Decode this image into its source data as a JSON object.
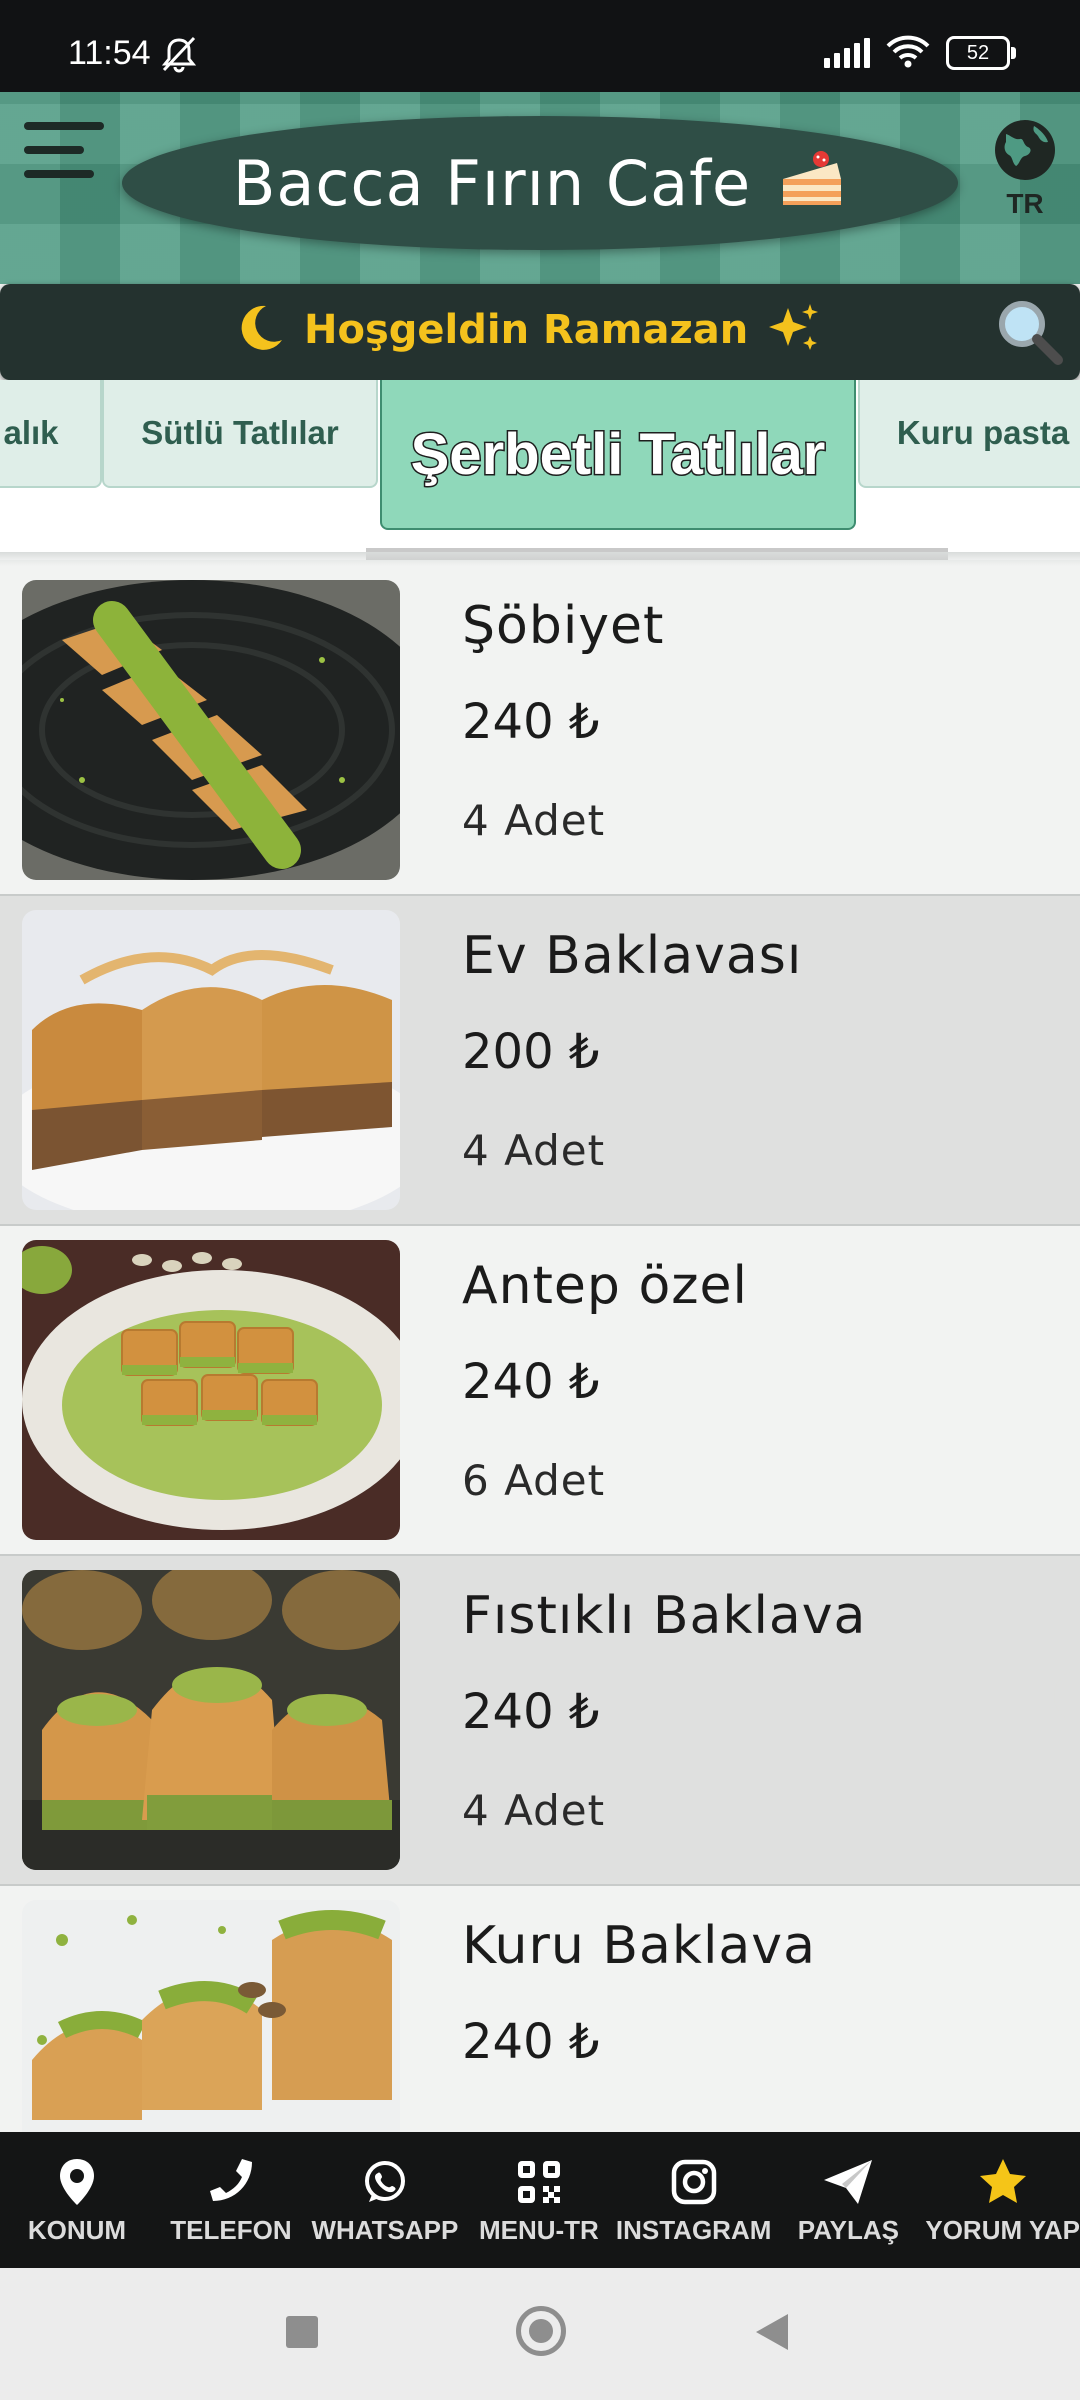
{
  "status_bar": {
    "time": "11:54",
    "battery": "52"
  },
  "header": {
    "title": "Bacca Fırın Cafe",
    "language": "TR"
  },
  "banner": {
    "text": "Hoşgeldin Ramazan"
  },
  "tabs": [
    {
      "label": "alık"
    },
    {
      "label": "Sütlü Tatlılar"
    },
    {
      "label": "Şerbetli Tatlılar",
      "active": true
    },
    {
      "label": "Kuru pasta"
    }
  ],
  "products": [
    {
      "name": "Şöbiyet",
      "price": "240 ₺",
      "quantity": "4 Adet"
    },
    {
      "name": "Ev Baklavası",
      "price": "200 ₺",
      "quantity": "4 Adet"
    },
    {
      "name": "Antep özel",
      "price": "240 ₺",
      "quantity": "6 Adet"
    },
    {
      "name": "Fıstıklı Baklava",
      "price": "240 ₺",
      "quantity": "4 Adet"
    },
    {
      "name": "Kuru Baklava",
      "price": "240 ₺",
      "quantity": ""
    }
  ],
  "bottom_nav": [
    {
      "label": "KONUM",
      "icon": "location-pin-icon"
    },
    {
      "label": "TELEFON",
      "icon": "phone-icon"
    },
    {
      "label": "WHATSAPP",
      "icon": "whatsapp-icon"
    },
    {
      "label": "MENU-TR",
      "icon": "qr-code-icon"
    },
    {
      "label": "INSTAGRAM",
      "icon": "instagram-icon"
    },
    {
      "label": "PAYLAŞ",
      "icon": "share-icon"
    },
    {
      "label": "YORUM YAP",
      "icon": "star-icon"
    }
  ],
  "colors": {
    "header_green": "#4e9a83",
    "banner_gold": "#f4c21d",
    "active_tab": "#8fd8ba",
    "nav_bg": "#141515",
    "star": "#f5c518"
  }
}
